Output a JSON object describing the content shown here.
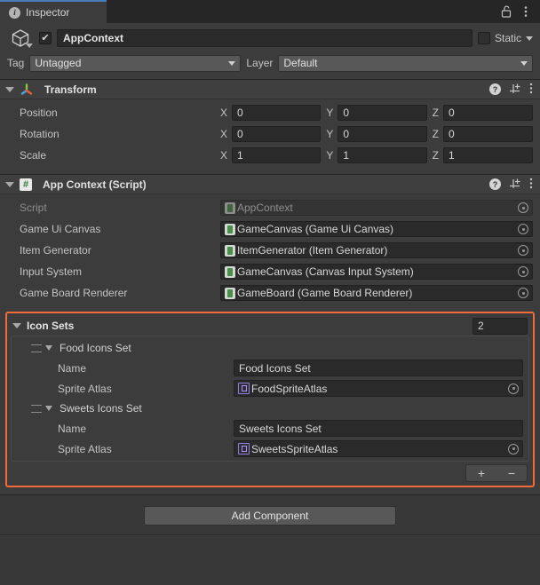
{
  "window": {
    "tab_label": "Inspector",
    "tab_icon": "info-circle-icon",
    "lock_icon": "unlocked-padlock-icon",
    "menu_icon": "kebab-menu-icon"
  },
  "gameobject": {
    "icon": "cube-icon",
    "enabled_checkbox": "✔",
    "name": "AppContext",
    "static_label": "Static",
    "tag_label": "Tag",
    "tag_value": "Untagged",
    "layer_label": "Layer",
    "layer_value": "Default"
  },
  "transform": {
    "title": "Transform",
    "icon": "transform-axis-icon",
    "help_icon": "help-circle-icon",
    "preset_icon": "preset-settings-icon",
    "menu_icon": "kebab-menu-icon",
    "rows": [
      {
        "label": "Position",
        "x": "0",
        "y": "0",
        "z": "0"
      },
      {
        "label": "Rotation",
        "x": "0",
        "y": "0",
        "z": "0"
      },
      {
        "label": "Scale",
        "x": "1",
        "y": "1",
        "z": "1"
      }
    ],
    "axes": {
      "x": "X",
      "y": "Y",
      "z": "Z"
    }
  },
  "app_context": {
    "title": "App Context (Script)",
    "icon": "csharp-script-icon",
    "help_icon": "help-circle-icon",
    "preset_icon": "preset-settings-icon",
    "menu_icon": "kebab-menu-icon",
    "fields": [
      {
        "label": "Script",
        "value": "AppContext",
        "icon": "script-asset-icon",
        "disabled": true
      },
      {
        "label": "Game Ui Canvas",
        "value": "GameCanvas (Game Ui Canvas)",
        "icon": "script-asset-icon",
        "disabled": false
      },
      {
        "label": "Item Generator",
        "value": "ItemGenerator (Item Generator)",
        "icon": "script-asset-icon",
        "disabled": false
      },
      {
        "label": "Input System",
        "value": "GameCanvas (Canvas Input System)",
        "icon": "script-asset-icon",
        "disabled": false
      },
      {
        "label": "Game Board Renderer",
        "value": "GameBoard (Game Board Renderer)",
        "icon": "script-asset-icon",
        "disabled": false
      }
    ]
  },
  "icon_sets": {
    "title": "Icon Sets",
    "size": "2",
    "highlight_color": "#f06a3c",
    "add_button": "+",
    "remove_button": "−",
    "elements": [
      {
        "title": "Food Icons Set",
        "name_label": "Name",
        "name_value": "Food Icons Set",
        "atlas_label": "Sprite Atlas",
        "atlas_value": "FoodSpriteAtlas",
        "atlas_icon": "sprite-atlas-icon"
      },
      {
        "title": "Sweets Icons Set",
        "name_label": "Name",
        "name_value": "Sweets Icons Set",
        "atlas_label": "Sprite Atlas",
        "atlas_value": "SweetsSpriteAtlas",
        "atlas_icon": "sprite-atlas-icon"
      }
    ]
  },
  "footer": {
    "add_component_label": "Add Component"
  }
}
